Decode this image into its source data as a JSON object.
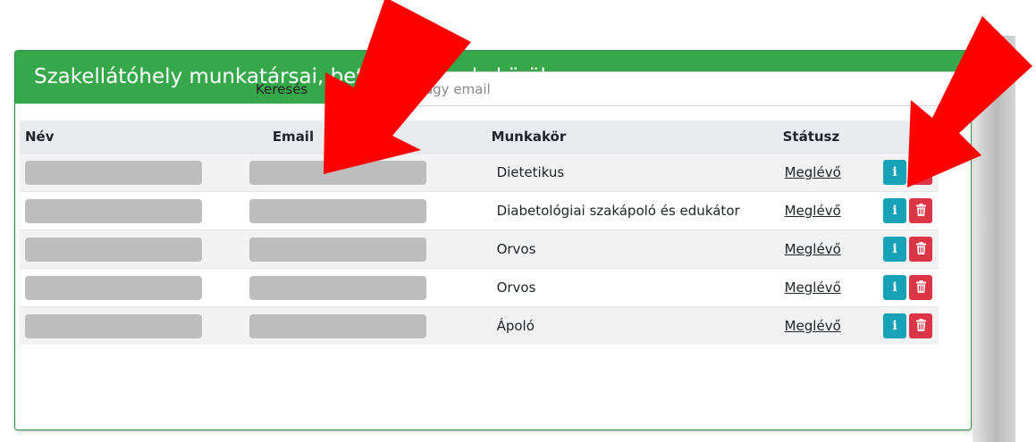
{
  "card": {
    "title": "Szakellátóhely munkatársai, betöltött munkakörök"
  },
  "search": {
    "label": "Keresés",
    "placeholder": "Név vagy email"
  },
  "table": {
    "headers": {
      "name": "Név",
      "email": "Email",
      "job": "Munkakör",
      "status": "Státusz"
    },
    "rows": [
      {
        "job": "Dietetikus",
        "status": "Meglévő"
      },
      {
        "job": "Diabetológiai szakápoló és edukátor",
        "status": "Meglévő"
      },
      {
        "job": "Orvos",
        "status": "Meglévő"
      },
      {
        "job": "Orvos",
        "status": "Meglévő"
      },
      {
        "job": "Ápoló",
        "status": "Meglévő"
      }
    ]
  },
  "icons": {
    "info": "info-icon",
    "delete": "trash-icon"
  },
  "colors": {
    "header_green": "#37a74c",
    "info_blue": "#17a2b8",
    "danger_red": "#dc3545",
    "annotation_arrow": "#ff0000"
  }
}
